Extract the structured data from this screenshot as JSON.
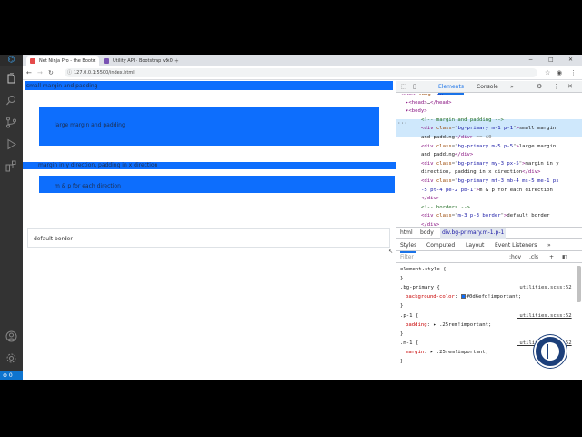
{
  "browser": {
    "tabs": [
      {
        "label": "Net Ninja Pro - the Bootc",
        "active": true
      },
      {
        "label": "Utility API · Bootstrap v5.0",
        "active": false
      }
    ],
    "new_tab": "+",
    "url": "127.0.0.1:5500/index.html",
    "controls": {
      "minimize": "−",
      "maximize": "□",
      "close": "✕"
    }
  },
  "page": {
    "box1": "small margin and padding",
    "box2": "large margin and padding",
    "box3": "margin in y direction, padding in x direction",
    "box4": "m & p for each direction",
    "box5": "default border",
    "brand_blue": "#0d6efd"
  },
  "devtools": {
    "tabs": {
      "elements": "Elements",
      "console": "Console",
      "more": "»"
    },
    "dom_lines": [
      {
        "indent": 0,
        "parts": [
          [
            "tag",
            "<html "
          ],
          [
            "attr",
            "lang"
          ],
          [
            "eq",
            "=\""
          ],
          [
            "val",
            "en"
          ],
          [
            "eq",
            "\""
          ],
          [
            "tag",
            ">"
          ]
        ]
      },
      {
        "indent": 1,
        "parts": [
          [
            "tag",
            "▸<head>"
          ],
          [
            "txt",
            "…"
          ],
          [
            "tag",
            "</head>"
          ]
        ]
      },
      {
        "indent": 1,
        "parts": [
          [
            "tag",
            "▾<body>"
          ]
        ]
      },
      {
        "indent": 2,
        "parts": [
          [
            "cmt",
            "<!-- margin and padding -->"
          ]
        ]
      },
      {
        "indent": 2,
        "parts": [
          [
            "tag",
            "<div "
          ],
          [
            "attr",
            "class"
          ],
          [
            "eq",
            "=\""
          ],
          [
            "val",
            "bg-primary m-1 p-1"
          ],
          [
            "eq",
            "\""
          ],
          [
            "tag",
            ">"
          ],
          [
            "txt",
            "small margin"
          ]
        ]
      },
      {
        "indent": 2,
        "parts": [
          [
            "txt",
            "and padding"
          ],
          [
            "tag",
            "</div>"
          ],
          [
            "eq",
            " == $0"
          ]
        ]
      },
      {
        "indent": 2,
        "parts": [
          [
            "tag",
            "<div "
          ],
          [
            "attr",
            "class"
          ],
          [
            "eq",
            "=\""
          ],
          [
            "val",
            "bg-primary m-5 p-5"
          ],
          [
            "eq",
            "\""
          ],
          [
            "tag",
            ">"
          ],
          [
            "txt",
            "large margin"
          ]
        ]
      },
      {
        "indent": 2,
        "parts": [
          [
            "txt",
            "and padding"
          ],
          [
            "tag",
            "</div>"
          ]
        ]
      },
      {
        "indent": 2,
        "parts": [
          [
            "tag",
            "<div "
          ],
          [
            "attr",
            "class"
          ],
          [
            "eq",
            "=\""
          ],
          [
            "val",
            "bg-primary my-3 px-5"
          ],
          [
            "eq",
            "\""
          ],
          [
            "tag",
            ">"
          ],
          [
            "txt",
            "margin in y"
          ]
        ]
      },
      {
        "indent": 2,
        "parts": [
          [
            "txt",
            "direction, padding in x direction"
          ],
          [
            "tag",
            "</div>"
          ]
        ]
      },
      {
        "indent": 2,
        "parts": [
          [
            "tag",
            "<div "
          ],
          [
            "attr",
            "class"
          ],
          [
            "eq",
            "=\""
          ],
          [
            "val",
            "bg-primary mt-3 mb-4 ms-5 me-1 ps"
          ]
        ]
      },
      {
        "indent": 2,
        "parts": [
          [
            "val",
            "-5 pt-4 pe-2 pb-1"
          ],
          [
            "eq",
            "\""
          ],
          [
            "tag",
            ">"
          ],
          [
            "txt",
            "m & p for each direction"
          ]
        ]
      },
      {
        "indent": 2,
        "parts": [
          [
            "tag",
            "</div>"
          ]
        ]
      },
      {
        "indent": 2,
        "parts": [
          [
            "cmt",
            "<!-- borders -->"
          ]
        ]
      },
      {
        "indent": 2,
        "parts": [
          [
            "tag",
            "<div "
          ],
          [
            "attr",
            "class"
          ],
          [
            "eq",
            "=\""
          ],
          [
            "val",
            "m-3 p-3 border"
          ],
          [
            "eq",
            "\""
          ],
          [
            "tag",
            ">"
          ],
          [
            "txt",
            "default border"
          ]
        ]
      },
      {
        "indent": 2,
        "parts": [
          [
            "tag",
            "</div>"
          ]
        ]
      }
    ],
    "breadcrumbs": [
      "html",
      "body",
      "div.bg-primary.m-1.p-1"
    ],
    "style_tabs": [
      "Styles",
      "Computed",
      "Layout",
      "Event Listeners",
      "»"
    ],
    "filter_placeholder": "Filter",
    "hov": ":hov",
    "cls": ".cls",
    "plus": "+",
    "rules": [
      {
        "kind": "sel",
        "text": "element.style {",
        "src": ""
      },
      {
        "kind": "end",
        "text": "}",
        "src": ""
      },
      {
        "kind": "sel",
        "text": ".bg-primary {",
        "src": "_utilities.scss:52"
      },
      {
        "kind": "decl",
        "prop": "background-color",
        "value": "#0d6efd!important;",
        "swatch": true
      },
      {
        "kind": "end",
        "text": "}",
        "src": ""
      },
      {
        "kind": "sel",
        "text": ".p-1 {",
        "src": "_utilities.scss:52"
      },
      {
        "kind": "decl",
        "prop": "padding",
        "value": "▸ .25rem!important;",
        "swatch": false
      },
      {
        "kind": "end",
        "text": "}",
        "src": ""
      },
      {
        "kind": "sel",
        "text": ".m-1 {",
        "src": "_utilities.scss:52"
      },
      {
        "kind": "decl",
        "prop": "margin",
        "value": "▸ .25rem!important;",
        "swatch": false
      },
      {
        "kind": "end",
        "text": "}",
        "src": ""
      }
    ]
  },
  "vscode": {
    "status": "⊗ 0"
  }
}
